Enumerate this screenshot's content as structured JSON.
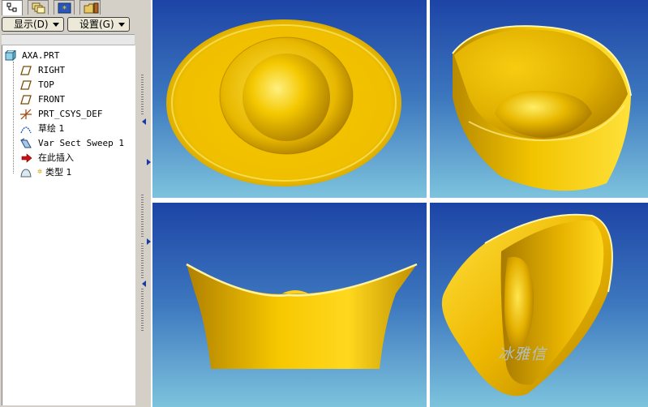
{
  "tabs": [
    {
      "icon": "model-tree-icon",
      "active": true
    },
    {
      "icon": "layers-icon",
      "active": false
    },
    {
      "icon": "favorites-icon",
      "active": false
    },
    {
      "icon": "folder-icon",
      "active": false
    }
  ],
  "toolbar": {
    "display_label": "显示(D)",
    "settings_label": "设置(G)"
  },
  "tree": {
    "root": {
      "label": "AXA.PRT",
      "icon": "part-icon"
    },
    "items": [
      {
        "label": "RIGHT",
        "icon": "datum-plane-icon"
      },
      {
        "label": "TOP",
        "icon": "datum-plane-icon"
      },
      {
        "label": "FRONT",
        "icon": "datum-plane-icon"
      },
      {
        "label": "PRT_CSYS_DEF",
        "icon": "coordinate-system-icon"
      },
      {
        "label": "草绘 1",
        "icon": "sketch-icon"
      },
      {
        "label": "Var Sect Sweep 1",
        "icon": "sweep-icon"
      },
      {
        "label": "在此插入",
        "icon": "insert-here-arrow-icon"
      },
      {
        "label": "类型 1",
        "icon": "style-feature-icon"
      }
    ]
  },
  "viewports": [
    {
      "name": "top-view"
    },
    {
      "name": "iso-view"
    },
    {
      "name": "front-view"
    },
    {
      "name": "side-iso-view"
    }
  ],
  "watermark": "冰雅信",
  "colors": {
    "gold": "#f2c80a",
    "bg_top": "#1d44a6",
    "bg_bottom": "#7dc3dd"
  }
}
